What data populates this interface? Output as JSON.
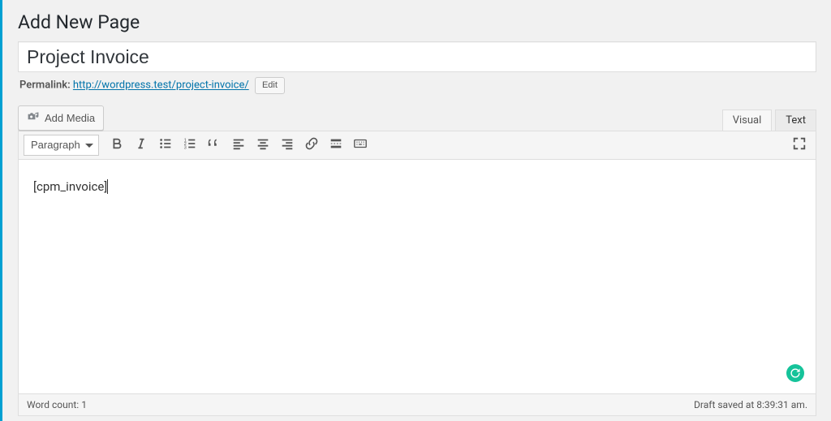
{
  "heading": "Add New Page",
  "title": {
    "value": "Project Invoice"
  },
  "permalink": {
    "label": "Permalink:",
    "url": "http://wordpress.test/project-invoice/",
    "edit_label": "Edit"
  },
  "media_button": {
    "label": "Add Media"
  },
  "tabs": {
    "visual": "Visual",
    "text": "Text"
  },
  "toolbar": {
    "format_selected": "Paragraph"
  },
  "editor": {
    "content": "[cpm_invoice]"
  },
  "status": {
    "word_count_label": "Word count:",
    "word_count": "1",
    "save_status": "Draft saved at 8:39:31 am."
  }
}
